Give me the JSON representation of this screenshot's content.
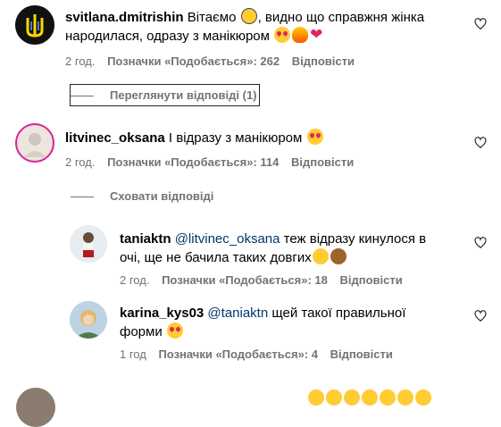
{
  "comments": [
    {
      "username": "svitlana.dmitrishin",
      "text_line1": "Вітаємо",
      "text_line1b": ", видно що справжня жінка",
      "text_line2": "народилася, одразу з манікюром",
      "time": "2 год.",
      "likes": "Позначки «Подобається»: 262",
      "reply": "Відповісти",
      "thread_toggle": "Переглянути відповіді (1)"
    },
    {
      "username": "litvinec_oksana",
      "text_line1": "І відразу з манікюром",
      "time": "2 год.",
      "likes": "Позначки «Подобається»: 114",
      "reply": "Відповісти",
      "thread_toggle": "Сховати відповіді"
    }
  ],
  "replies": [
    {
      "username": "taniaktn",
      "mention": "@litvinec_oksana",
      "text_line1": "теж відразу кинулося в",
      "text_line2": "очі, ще не бачила таких довгих",
      "time": "2 год.",
      "likes": "Позначки «Подобається»: 18",
      "reply": "Відповісти"
    },
    {
      "username": "karina_kys03",
      "mention": "@taniaktn",
      "text_line1": "щей такої правильної",
      "text_line2": "форми",
      "time": "1 год",
      "likes": "Позначки «Подобається»: 4",
      "reply": "Відповісти"
    }
  ],
  "colors": {
    "text": "#000000",
    "secondary": "#737373",
    "mention": "#00376b"
  }
}
